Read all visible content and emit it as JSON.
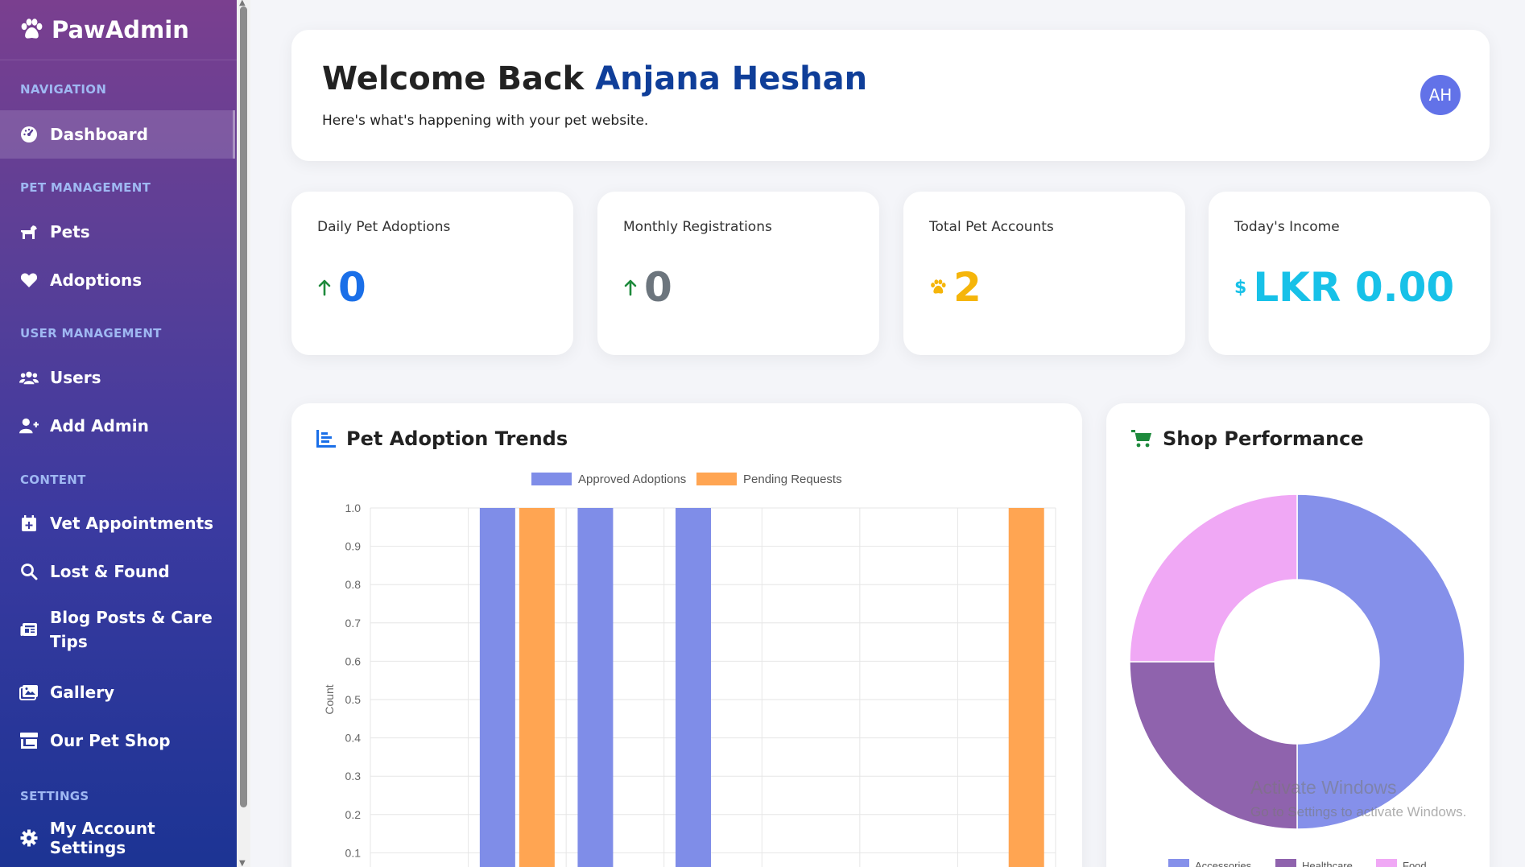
{
  "brand": {
    "name": "PawAdmin",
    "icon": "paw-icon"
  },
  "sidebar": {
    "sections": {
      "navigation": "NAVIGATION",
      "pet_management": "PET MANAGEMENT",
      "user_management": "USER MANAGEMENT",
      "content": "CONTENT",
      "settings": "SETTINGS"
    },
    "items": {
      "dashboard": {
        "label": "Dashboard",
        "icon": "gauge-icon",
        "active": true
      },
      "pets": {
        "label": "Pets",
        "icon": "dog-icon"
      },
      "adoptions": {
        "label": "Adoptions",
        "icon": "heart-icon"
      },
      "users": {
        "label": "Users",
        "icon": "users-icon"
      },
      "add_admin": {
        "label": "Add Admin",
        "icon": "user-plus-icon"
      },
      "vet_appointments": {
        "label": "Vet Appointments",
        "icon": "calendar-plus-icon"
      },
      "lost_found": {
        "label": "Lost & Found",
        "icon": "search-icon"
      },
      "blog_posts_line1": "Blog Posts & Care",
      "blog_posts_line2": "Tips",
      "gallery": {
        "label": "Gallery",
        "icon": "images-icon"
      },
      "pet_shop": {
        "label": "Our Pet Shop",
        "icon": "store-icon"
      },
      "account_settings": {
        "label": "My Account Settings",
        "icon": "gear-icon"
      }
    }
  },
  "header": {
    "welcome_prefix": "Welcome Back",
    "user_name": "Anjana Heshan",
    "subtitle": "Here's what's happening with your pet website.",
    "avatar_initials": "AH"
  },
  "stats": [
    {
      "label": "Daily Pet Adoptions",
      "value": "0",
      "icon": "arrow-up-icon",
      "color": "#1a6fe8"
    },
    {
      "label": "Monthly Registrations",
      "value": "0",
      "icon": "arrow-up-icon",
      "color": "#6c757d"
    },
    {
      "label": "Total Pet Accounts",
      "value": "2",
      "icon": "paw-icon",
      "color": "#f5b50a"
    },
    {
      "label": "Today's Income",
      "value": "LKR 0.00",
      "icon": "dollar-icon",
      "color": "#17c1e8"
    }
  ],
  "adoption_panel": {
    "title": "Pet Adoption Trends",
    "icon": "chart-bar-icon"
  },
  "shop_panel": {
    "title": "Shop Performance",
    "icon": "cart-icon"
  },
  "chart_data": [
    {
      "type": "bar",
      "ylabel": "Count",
      "ylim": [
        0,
        1.0
      ],
      "y_ticks": [
        "1.0",
        "0.9",
        "0.8",
        "0.7",
        "0.6",
        "0.5",
        "0.4",
        "0.3",
        "0.2",
        "0.1"
      ],
      "legend_position": "top",
      "series": [
        {
          "name": "Approved Adoptions",
          "color": "#7f8de8",
          "values": [
            0,
            1,
            1,
            1,
            0,
            0,
            0
          ]
        },
        {
          "name": "Pending Requests",
          "color": "#ffa552",
          "values": [
            0,
            1,
            0,
            0,
            0,
            0,
            1
          ]
        }
      ]
    },
    {
      "type": "pie",
      "variant": "doughnut",
      "legend_position": "bottom",
      "slices": [
        {
          "name": "Accessories",
          "value": 50,
          "color": "#8590ea"
        },
        {
          "name": "Healthcare",
          "value": 25,
          "color": "#8f63ad"
        },
        {
          "name": "Food",
          "value": 25,
          "color": "#f0a8f5"
        }
      ]
    }
  ],
  "watermark": {
    "line1": "Activate Windows",
    "line2": "Go to Settings to activate Windows."
  }
}
